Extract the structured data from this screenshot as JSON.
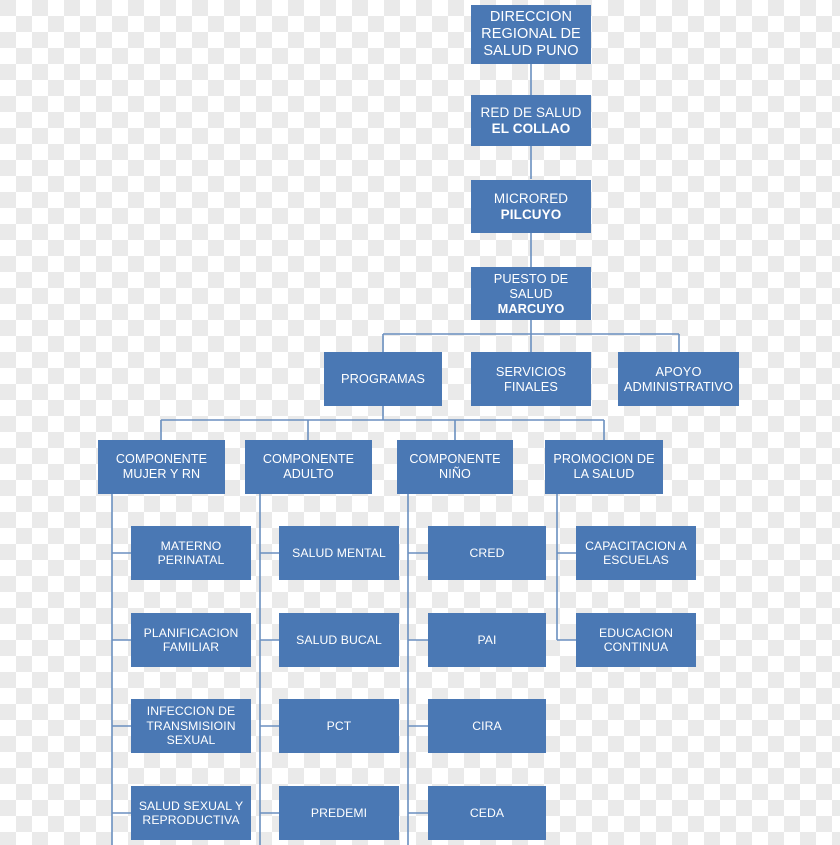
{
  "diagram": {
    "type": "organizational-chart",
    "accent_color": "#4a78b4",
    "line_color": "#6b8fc0",
    "text_color": "#ffffff",
    "nodes": {
      "root": {
        "line1": "DIRECCION",
        "line2": "REGIONAL DE",
        "line3": "SALUD PUNO"
      },
      "red": {
        "line1": "RED DE SALUD",
        "line2": "EL COLLAO"
      },
      "microred": {
        "line1": "MICRORED",
        "line2": "PILCUYO"
      },
      "puesto": {
        "line1": "PUESTO DE SALUD",
        "line2": "MARCUYO"
      },
      "programas": {
        "line1": "PROGRAMAS"
      },
      "servicios": {
        "line1": "SERVICIOS",
        "line2": "FINALES"
      },
      "apoyo": {
        "line1": "APOYO",
        "line2": "ADMINISTRATIVO"
      },
      "comp_mujer": {
        "line1": "COMPONENTE",
        "line2": "MUJER Y RN"
      },
      "comp_adulto": {
        "line1": "COMPONENTE",
        "line2": "ADULTO"
      },
      "comp_nino": {
        "line1": "COMPONENTE",
        "line2": "NIÑO"
      },
      "promocion": {
        "line1": "PROMOCION DE",
        "line2": "LA SALUD"
      },
      "materno": {
        "line1": "MATERNO",
        "line2": "PERINATAL"
      },
      "planificacion": {
        "line1": "PLANIFICACION",
        "line2": "FAMILIAR"
      },
      "its": {
        "line1": "INFECCION DE",
        "line2": "TRANSMISIOIN",
        "line3": "SEXUAL"
      },
      "salud_sexual": {
        "line1": "SALUD SEXUAL Y",
        "line2": "REPRODUCTIVA"
      },
      "salud_mental": {
        "line1": "SALUD MENTAL"
      },
      "salud_bucal": {
        "line1": "SALUD BUCAL"
      },
      "pct": {
        "line1": "PCT"
      },
      "predemi": {
        "line1": "PREDEMI"
      },
      "cred": {
        "line1": "CRED"
      },
      "pai": {
        "line1": "PAI"
      },
      "cira": {
        "line1": "CIRA"
      },
      "ceda": {
        "line1": "CEDA"
      },
      "capacitacion": {
        "line1": "CAPACITACION A",
        "line2": "ESCUELAS"
      },
      "educacion": {
        "line1": "EDUCACION",
        "line2": "CONTINUA"
      }
    }
  }
}
